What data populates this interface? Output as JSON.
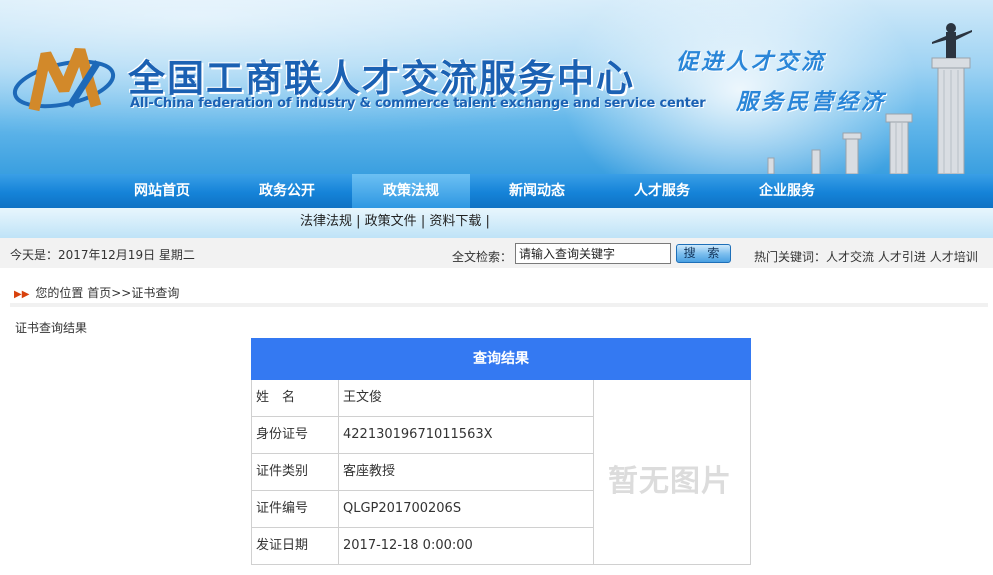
{
  "header": {
    "title_cn": "全国工商联人才交流服务中心",
    "title_en": "All-China federation of industry & commerce talent exchange and service center",
    "slogan_line1": "促进人才交流",
    "slogan_line2": "服务民营经济"
  },
  "nav": {
    "items": [
      {
        "label": "网站首页"
      },
      {
        "label": "政务公开"
      },
      {
        "label": "政策法规"
      },
      {
        "label": "新闻动态"
      },
      {
        "label": "人才服务"
      },
      {
        "label": "企业服务"
      }
    ],
    "active_index": 2
  },
  "subnav": {
    "items": [
      {
        "label": "法律法规"
      },
      {
        "label": "政策文件"
      },
      {
        "label": "资料下载"
      }
    ]
  },
  "infobar": {
    "date": "今天是：2017年12月19日 星期二",
    "search_label": "全文检索：",
    "search_value": "请输入查询关键字",
    "search_button": "搜 索",
    "hot_label": "热门关键词：",
    "hot_words": [
      "人才交流",
      "人才引进",
      "人才培训"
    ]
  },
  "breadcrumb": {
    "label": "您的位置",
    "home": "首页",
    "current": ">>证书查询"
  },
  "section_title": "证书查询结果",
  "result": {
    "heading": "查询结果",
    "rows": [
      {
        "label": "姓　名",
        "value": "王文俊"
      },
      {
        "label": "身份证号",
        "value": "42213019671011563X"
      },
      {
        "label": "证件类别",
        "value": "客座教授"
      },
      {
        "label": "证件编号",
        "value": "QLGP201700206S"
      },
      {
        "label": "发证日期",
        "value": "2017-12-18 0:00:00"
      }
    ],
    "photo_placeholder": "暂无图片"
  },
  "colors": {
    "nav_blue": "#1583d8",
    "result_header": "#3479f2",
    "title_blue": "#1b61b3"
  }
}
